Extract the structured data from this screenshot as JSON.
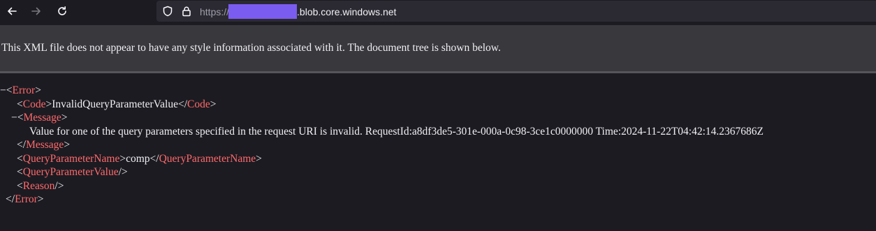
{
  "browser": {
    "url_scheme": "https://",
    "url_host": ".blob.core.windows.net",
    "icons": {
      "back": "arrow-left-icon",
      "forward": "arrow-right-icon",
      "reload": "reload-icon",
      "tracking_protection": "shield-icon",
      "lock": "lock-icon"
    },
    "redaction_color": "#7b5cf0"
  },
  "xml_viewer": {
    "info_message": "This XML file does not appear to have any style information associated with it. The document tree is shown below.",
    "collapse_toggle": "−",
    "tree": {
      "error_tag": "Error",
      "code_tag": "Code",
      "code_value": "InvalidQueryParameterValue",
      "message_tag": "Message",
      "message_value": "Value for one of the query parameters specified in the request URI is invalid. RequestId:a8df3de5-301e-000a-0c98-3ce1c0000000 Time:2024-11-22T04:42:14.2367686Z",
      "param_name_tag": "QueryParameterName",
      "param_name_value": "comp",
      "param_value_tag": "QueryParameterValue",
      "reason_tag": "Reason"
    },
    "tag_color": "#ff6a6a",
    "text_color": "#f0f0f2"
  }
}
